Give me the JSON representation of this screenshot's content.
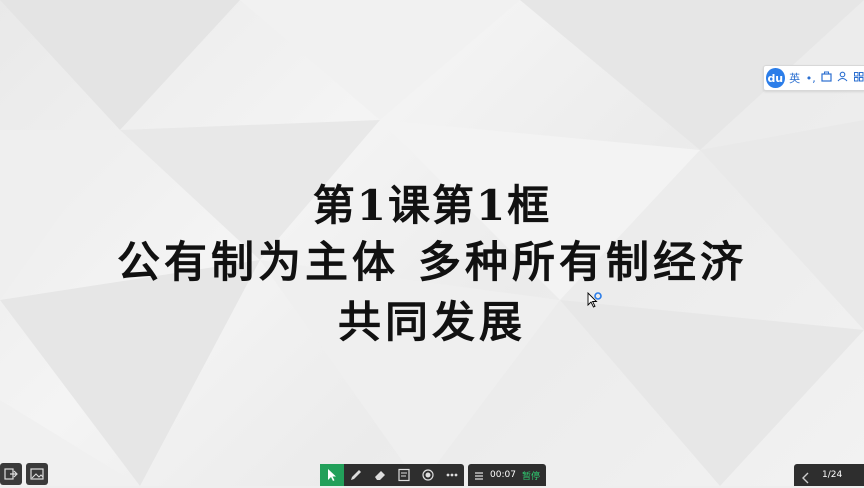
{
  "slide": {
    "title_line1": "第1课第1框",
    "title_line2": "公有制为主体  多种所有制经济",
    "title_line3": "共同发展"
  },
  "ime_toolbar": {
    "logo": "du",
    "mode_label": "英",
    "punct_label": "•,",
    "icons": [
      "toolbox-icon",
      "user-icon",
      "grid-icon"
    ]
  },
  "bottom_toolbar": {
    "tools": [
      "pointer-icon",
      "pen-icon",
      "eraser-icon",
      "note-icon",
      "record-icon",
      "more-icon"
    ],
    "timer": "00:07",
    "pause_label": "暂停"
  },
  "pager": {
    "page_indicator": "1/24"
  },
  "colors": {
    "accent_active": "#22a05a",
    "ime_blue": "#2b7de9",
    "pause_green": "#2ecc71"
  }
}
